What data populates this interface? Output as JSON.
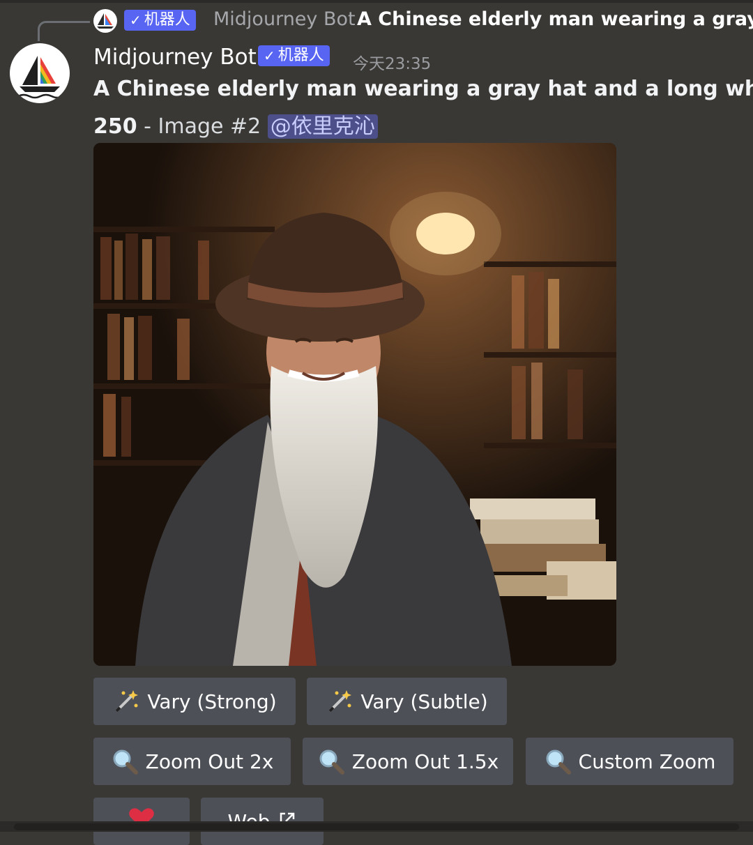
{
  "reply": {
    "bot_name": "Midjourney Bot",
    "badge_label": "机器人",
    "prompt_preview": "A Chinese elderly man wearing a gray hat and a long white beard"
  },
  "message": {
    "author": "Midjourney Bot",
    "badge_label": "机器人",
    "timestamp": "今天23:35",
    "prompt": "A Chinese elderly man wearing a gray hat and a long white beard",
    "meta_number": "250",
    "meta_separator": " - ",
    "meta_image": "Image #2",
    "mention": "@依里克沁"
  },
  "image": {
    "alt": "Elderly Chinese man with gray hat and long white beard in a library"
  },
  "buttons": {
    "vary_strong": "Vary (Strong)",
    "vary_subtle": "Vary (Subtle)",
    "zoom_out_2x": "Zoom Out 2x",
    "zoom_out_15x": "Zoom Out 1.5x",
    "custom_zoom": "Custom Zoom",
    "web": "Web"
  },
  "icons": {
    "badge_check": "check-icon",
    "vary": "magic-wand-icon",
    "zoom": "magnifier-icon",
    "favorite": "heart-icon",
    "external": "external-link-icon"
  },
  "colors": {
    "background": "#3a3835",
    "badge": "#5865f2",
    "button": "#4e5058",
    "mention_bg": "#4c4f8a"
  }
}
